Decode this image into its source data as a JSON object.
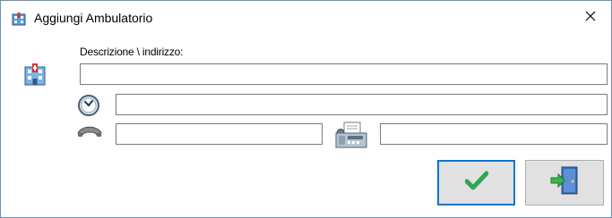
{
  "window": {
    "title": "Aggiungi Ambulatorio",
    "title_icon": "building-icon",
    "close_icon": "close-icon"
  },
  "form": {
    "description_label": "Descrizione \\ indirizzo:",
    "description_value": "",
    "hours_value": "",
    "phone_value": "",
    "fax_value": ""
  },
  "icons": {
    "building": "building-icon",
    "clock": "clock-icon",
    "phone": "phone-icon",
    "fax": "fax-icon"
  },
  "buttons": {
    "confirm_icon": "checkmark-icon",
    "exit_icon": "exit-door-icon"
  },
  "colors": {
    "accent": "#0078d7",
    "check_green": "#2fa84f",
    "button_face": "#e1e1e1"
  }
}
